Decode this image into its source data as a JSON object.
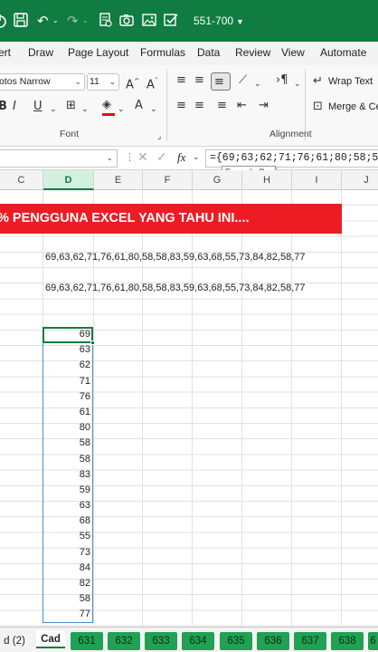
{
  "titlebar": {
    "file_title": "551-700",
    "accent": "#107c41"
  },
  "ribbon_tabs": [
    "ert",
    "Draw",
    "Page Layout",
    "Formulas",
    "Data",
    "Review",
    "View",
    "Automate"
  ],
  "ribbon": {
    "font_name": "otos Narrow",
    "font_size": "11",
    "wrap_text": "Wrap Text",
    "merge_center": "Merge & Ce",
    "group_font": "Font",
    "group_alignment": "Alignment"
  },
  "formula_bar": {
    "fx": "fx",
    "content": "={69;63;62;71;76;61;80;58;58;5",
    "tooltip": "Formula Bar"
  },
  "columns": [
    "C",
    "D",
    "E",
    "F",
    "G",
    "H",
    "I",
    "J"
  ],
  "sheet": {
    "banner": "% PENGGUNA EXCEL YANG TAHU INI....",
    "row_text_1": "69,63,62,71,76,61,80,58,58,83,59,63,68,55,73,84,82,58,77",
    "row_text_2": "69,63,62,71,76,61,80,58,58,83,59,63,68,55,73,84,82,58,77",
    "column_values": [
      "69",
      "63",
      "62",
      "71",
      "76",
      "61",
      "80",
      "58",
      "58",
      "83",
      "59",
      "63",
      "68",
      "55",
      "73",
      "84",
      "82",
      "58",
      "77"
    ],
    "banner_color": "#ed1c24"
  },
  "sheet_tabs": {
    "prev": "d (2)",
    "current": "Cad",
    "numbered": [
      "631",
      "632",
      "633",
      "634",
      "635",
      "636",
      "637",
      "638",
      "6"
    ],
    "tab_color": "#21a153"
  }
}
